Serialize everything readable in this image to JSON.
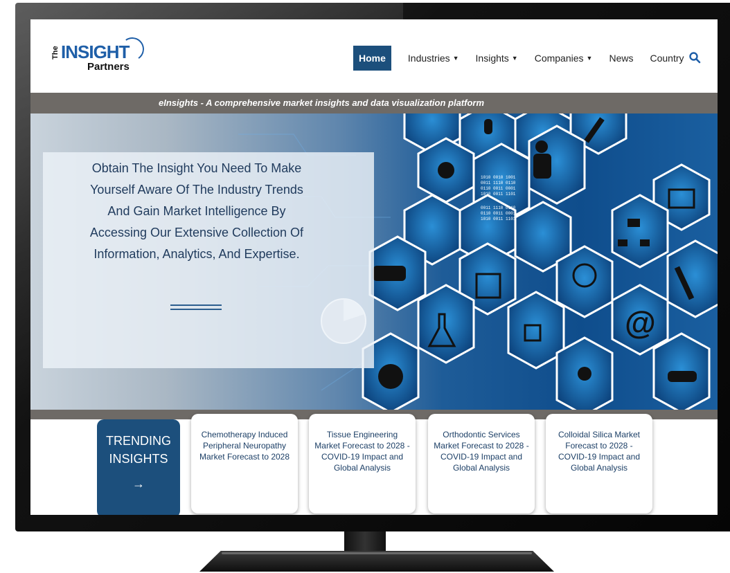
{
  "header": {
    "logo": {
      "the": "The",
      "insight": "INSIGHT",
      "partners": "Partners"
    },
    "nav": [
      {
        "label": "Home",
        "active": true,
        "dropdown": false
      },
      {
        "label": "Industries",
        "active": false,
        "dropdown": true
      },
      {
        "label": "Insights",
        "active": false,
        "dropdown": true
      },
      {
        "label": "Companies",
        "active": false,
        "dropdown": true
      },
      {
        "label": "News",
        "active": false,
        "dropdown": false
      },
      {
        "label": "Country",
        "active": false,
        "dropdown": false
      }
    ],
    "search_icon": "search-icon"
  },
  "banner": {
    "tagline": "eInsights - A comprehensive market insights and data visualization platform"
  },
  "hero": {
    "line1": "Obtain The Insight You Need To Make",
    "line2": "Yourself Aware Of The Industry Trends",
    "line3": "And Gain Market Intelligence By",
    "line4": "Accessing Our Extensive Collection Of",
    "line5": "Information, Analytics, And Expertise."
  },
  "trending": {
    "label_line1": "TRENDING",
    "label_line2": "INSIGHTS",
    "arrow": "→",
    "cards": [
      {
        "title": "Chemotherapy Induced Peripheral Neuropathy Market Forecast to 2028"
      },
      {
        "title": "Tissue Engineering Market Forecast to 2028 - COVID-19 Impact and Global Analysis"
      },
      {
        "title": "Orthodontic Services Market Forecast to 2028 - COVID-19 Impact and Global Analysis"
      },
      {
        "title": "Colloidal Silica Market Forecast to 2028 - COVID-19 Impact and Global Analysis"
      }
    ]
  },
  "colors": {
    "brand_blue": "#1c4f7c",
    "logo_blue": "#1f5fa8",
    "banner_gray": "#6e6a66"
  }
}
